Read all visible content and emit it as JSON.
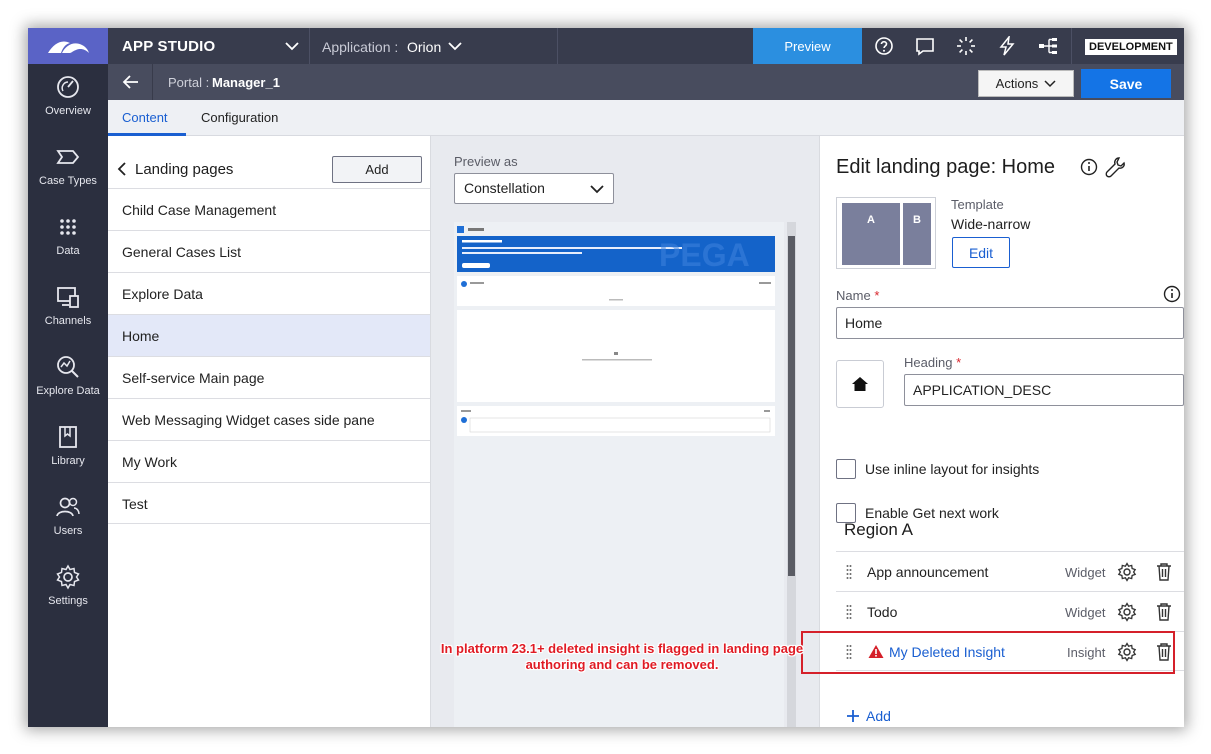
{
  "topbar": {
    "app_name": "APP STUDIO",
    "application_label": "Application :",
    "application_value": "Orion",
    "preview_label": "Preview",
    "environment_badge": "DEVELOPMENT"
  },
  "rail": {
    "items": [
      {
        "label": "Overview",
        "icon": "overview-icon"
      },
      {
        "label": "Case Types",
        "icon": "case-types-icon"
      },
      {
        "label": "Data",
        "icon": "data-icon"
      },
      {
        "label": "Channels",
        "icon": "channels-icon"
      },
      {
        "label": "Explore Data",
        "icon": "explore-data-icon"
      },
      {
        "label": "Library",
        "icon": "library-icon"
      },
      {
        "label": "Users",
        "icon": "users-icon"
      },
      {
        "label": "Settings",
        "icon": "settings-icon"
      }
    ]
  },
  "subbar": {
    "portal_label": "Portal :",
    "portal_value": "Manager_1",
    "actions_label": "Actions",
    "save_label": "Save"
  },
  "tabs": {
    "content": "Content",
    "configuration": "Configuration"
  },
  "landing_pages": {
    "title": "Landing pages",
    "add_label": "Add",
    "selected": "Home",
    "items": [
      "Child Case Management",
      "General Cases List",
      "Explore Data",
      "Home",
      "Self-service Main page",
      "Web Messaging Widget cases side pane",
      "My Work",
      "Test"
    ]
  },
  "preview": {
    "label": "Preview as",
    "selected_option": "Constellation"
  },
  "edit": {
    "title": "Edit landing page: Home",
    "template_label": "Template",
    "template_value": "Wide-narrow",
    "template_regions": [
      "A",
      "B"
    ],
    "edit_label": "Edit",
    "name_label": "Name",
    "name_value": "Home",
    "heading_label": "Heading",
    "heading_value": "APPLICATION_DESC",
    "icon": "home-icon",
    "inline_layout_label": "Use inline layout for insights",
    "get_next_label": "Enable Get next work",
    "region_title": "Region A",
    "region_items": [
      {
        "name": "App announcement",
        "type": "Widget"
      },
      {
        "name": "Todo",
        "type": "Widget"
      },
      {
        "name": "My Deleted Insight",
        "type": "Insight",
        "warning": true
      }
    ],
    "add_label": "Add"
  },
  "annotation": {
    "line1": "In platform 23.1+ deleted insight is flagged in landing page",
    "line2": "authoring and can be removed."
  },
  "colors": {
    "rail_bg": "#2b2f3f",
    "logo_bg": "#5a63c6",
    "preview_button": "#2b8fe0",
    "save_button": "#1474e6",
    "link_blue": "#1a5fd1",
    "warning_red": "#d5202a"
  }
}
